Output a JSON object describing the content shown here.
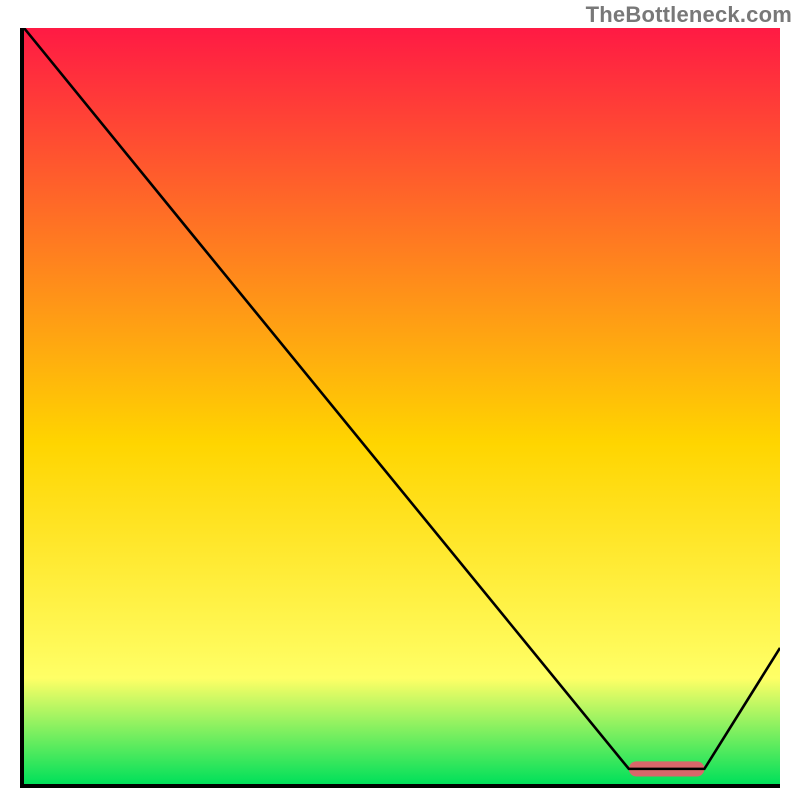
{
  "attribution": "TheBottleneck.com",
  "chart_data": {
    "type": "line",
    "title": "",
    "xlabel": "",
    "ylabel": "",
    "xlim": [
      0,
      100
    ],
    "ylim": [
      0,
      100
    ],
    "grid": false,
    "legend": false,
    "background_gradient": {
      "top_color": "#ff1a44",
      "middle_color": "#ffd500",
      "lower_color": "#ffff66",
      "bottom_color": "#00e05a"
    },
    "series": [
      {
        "name": "curve",
        "color": "#000000",
        "x": [
          0,
          22,
          80,
          84,
          90,
          100
        ],
        "y": [
          100,
          73,
          2,
          2,
          2,
          18
        ]
      }
    ],
    "indicator_bar": {
      "x_start": 80,
      "x_end": 90,
      "y": 2,
      "color": "#d9676a"
    }
  }
}
